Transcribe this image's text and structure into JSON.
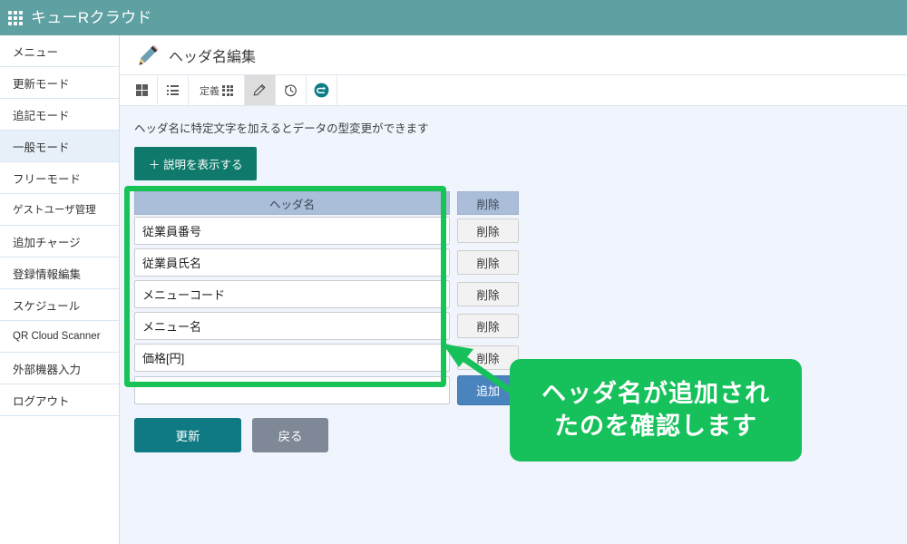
{
  "header": {
    "apps_icon": "apps-grid-icon",
    "brand": "キューRクラウド",
    "bg_color": "#5fa0a3"
  },
  "sidebar": {
    "items": [
      {
        "label": "メニュー",
        "active": false
      },
      {
        "label": "更新モード",
        "active": false
      },
      {
        "label": "追記モード",
        "active": false
      },
      {
        "label": "一般モード",
        "active": true
      },
      {
        "label": "フリーモード",
        "active": false
      },
      {
        "label": "ゲストユーザ管理",
        "active": false
      },
      {
        "label": "追加チャージ",
        "active": false
      },
      {
        "label": "登録情報編集",
        "active": false
      },
      {
        "label": "スケジュール",
        "active": false
      },
      {
        "label": "QR Cloud Scanner",
        "active": false
      },
      {
        "label": "外部機器入力",
        "active": false
      },
      {
        "label": "ログアウト",
        "active": false
      }
    ]
  },
  "page": {
    "icon": "pencil-icon",
    "title": "ヘッダ名編集"
  },
  "toolbar": {
    "buttons": [
      {
        "name": "grid-view-icon",
        "label": "",
        "active": false
      },
      {
        "name": "list-view-icon",
        "label": "",
        "active": false
      },
      {
        "name": "definition-grid-icon",
        "label": "定義",
        "active": false
      },
      {
        "name": "pencil-edit-icon",
        "label": "",
        "active": true
      },
      {
        "name": "history-clock-icon",
        "label": "",
        "active": false
      },
      {
        "name": "undo-return-icon",
        "label": "",
        "active": false
      }
    ]
  },
  "content": {
    "hint_text": "ヘッダ名に特定文字を加えるとデータの型変更ができます",
    "description_button": "＋ 説明を表示する",
    "table": {
      "columns": [
        "ヘッダ名",
        "削除"
      ],
      "rows": [
        {
          "value": "従業員番号",
          "delete_label": "削除"
        },
        {
          "value": "従業員氏名",
          "delete_label": "削除"
        },
        {
          "value": "メニューコード",
          "delete_label": "削除"
        },
        {
          "value": "メニュー名",
          "delete_label": "削除"
        },
        {
          "value": "価格[円]",
          "delete_label": "削除"
        }
      ],
      "new_row": {
        "value": "",
        "placeholder": "",
        "add_label": "追加"
      }
    },
    "actions": {
      "update_label": "更新",
      "back_label": "戻る"
    }
  },
  "annotation": {
    "highlight_color": "#18c356",
    "callout_color": "#16c05a",
    "callout_line1": "ヘッダ名が追加され",
    "callout_line2": "たのを確認します"
  }
}
